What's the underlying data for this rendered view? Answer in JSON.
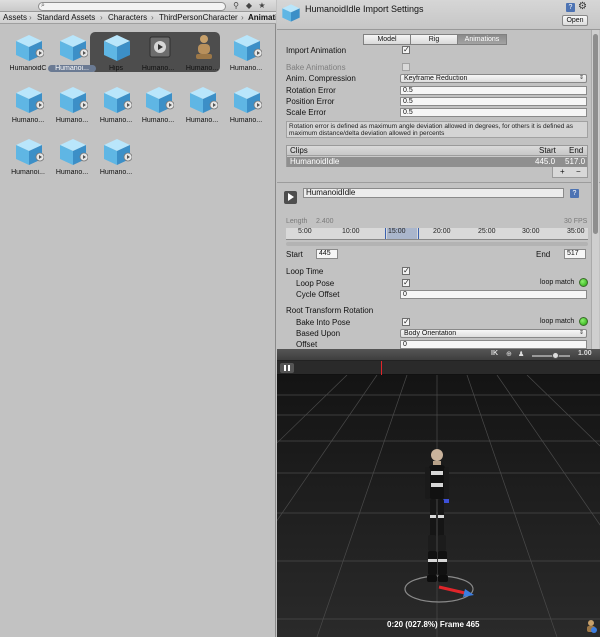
{
  "project": {
    "search_placeholder": "",
    "breadcrumb": [
      "Assets",
      "Standard Assets",
      "Characters",
      "ThirdPersonCharacter",
      "Animation"
    ],
    "assets": [
      {
        "label": "HumanoidC"
      },
      {
        "label": "Humanoi..."
      },
      {
        "label": "Hips"
      },
      {
        "label": "Humano..."
      },
      {
        "label": "Humano..."
      },
      {
        "label": "Humano..."
      },
      {
        "label": "Humano..."
      },
      {
        "label": "Humano..."
      },
      {
        "label": "Humano..."
      },
      {
        "label": "Humano..."
      },
      {
        "label": "Humano..."
      },
      {
        "label": "Humano..."
      },
      {
        "label": "Humanoi..."
      },
      {
        "label": "Humano..."
      },
      {
        "label": "Humano..."
      }
    ]
  },
  "inspector": {
    "title": "HumanoidIdle Import Settings",
    "open_button": "Open",
    "tabs": [
      {
        "label": "Model"
      },
      {
        "label": "Rig"
      },
      {
        "label": "Animations"
      }
    ],
    "fields": {
      "import_animation": "Import Animation",
      "bake_animations": "Bake Animations",
      "anim_compression": "Anim. Compression",
      "anim_compression_value": "Keyframe Reduction",
      "rotation_error": "Rotation Error",
      "rotation_error_value": "0.5",
      "position_error": "Position Error",
      "position_error_value": "0.5",
      "scale_error": "Scale Error",
      "scale_error_value": "0.5"
    },
    "help_text": "Rotation error is defined as maximum angle deviation allowed in degrees, for others it is defined as maximum distance/delta deviation allowed in percents",
    "clips": {
      "header": {
        "name": "Clips",
        "start": "Start",
        "end": "End"
      },
      "rows": [
        {
          "name": "HumanoidIdle",
          "start": "445.0",
          "end": "517.0"
        }
      ],
      "add": "+",
      "remove": "−"
    },
    "clip": {
      "name": "HumanoidIdle",
      "length_label": "Length",
      "length_value": "2.400",
      "fps": "30 FPS",
      "ruler_ticks": [
        "5:00",
        "10:00",
        "15:00",
        "20:00",
        "25:00",
        "30:00",
        "35:00"
      ],
      "start_label": "Start",
      "start_value": "445",
      "end_label": "End",
      "end_value": "517"
    },
    "loop": {
      "loop_time": "Loop Time",
      "loop_pose": "Loop Pose",
      "loop_match": "loop match",
      "cycle_offset": "Cycle Offset",
      "cycle_offset_value": "0"
    },
    "root_rotation": {
      "header": "Root Transform Rotation",
      "bake_into_pose": "Bake Into Pose",
      "loop_match": "loop match",
      "based_upon": "Based Upon",
      "based_upon_value": "Body Orientation",
      "offset": "Offset",
      "offset_value": "0"
    }
  },
  "preview": {
    "ik_label": "IK",
    "speed_value": "1.00",
    "status": "0:20 (027.8%) Frame 465"
  },
  "colors": {
    "ui_bg": "#c2c2c2",
    "preview_bg": "#1b1b1b",
    "accent_blue": "#4d73b3",
    "loop_green": "#24a70c",
    "playhead_red": "#e0252a"
  }
}
